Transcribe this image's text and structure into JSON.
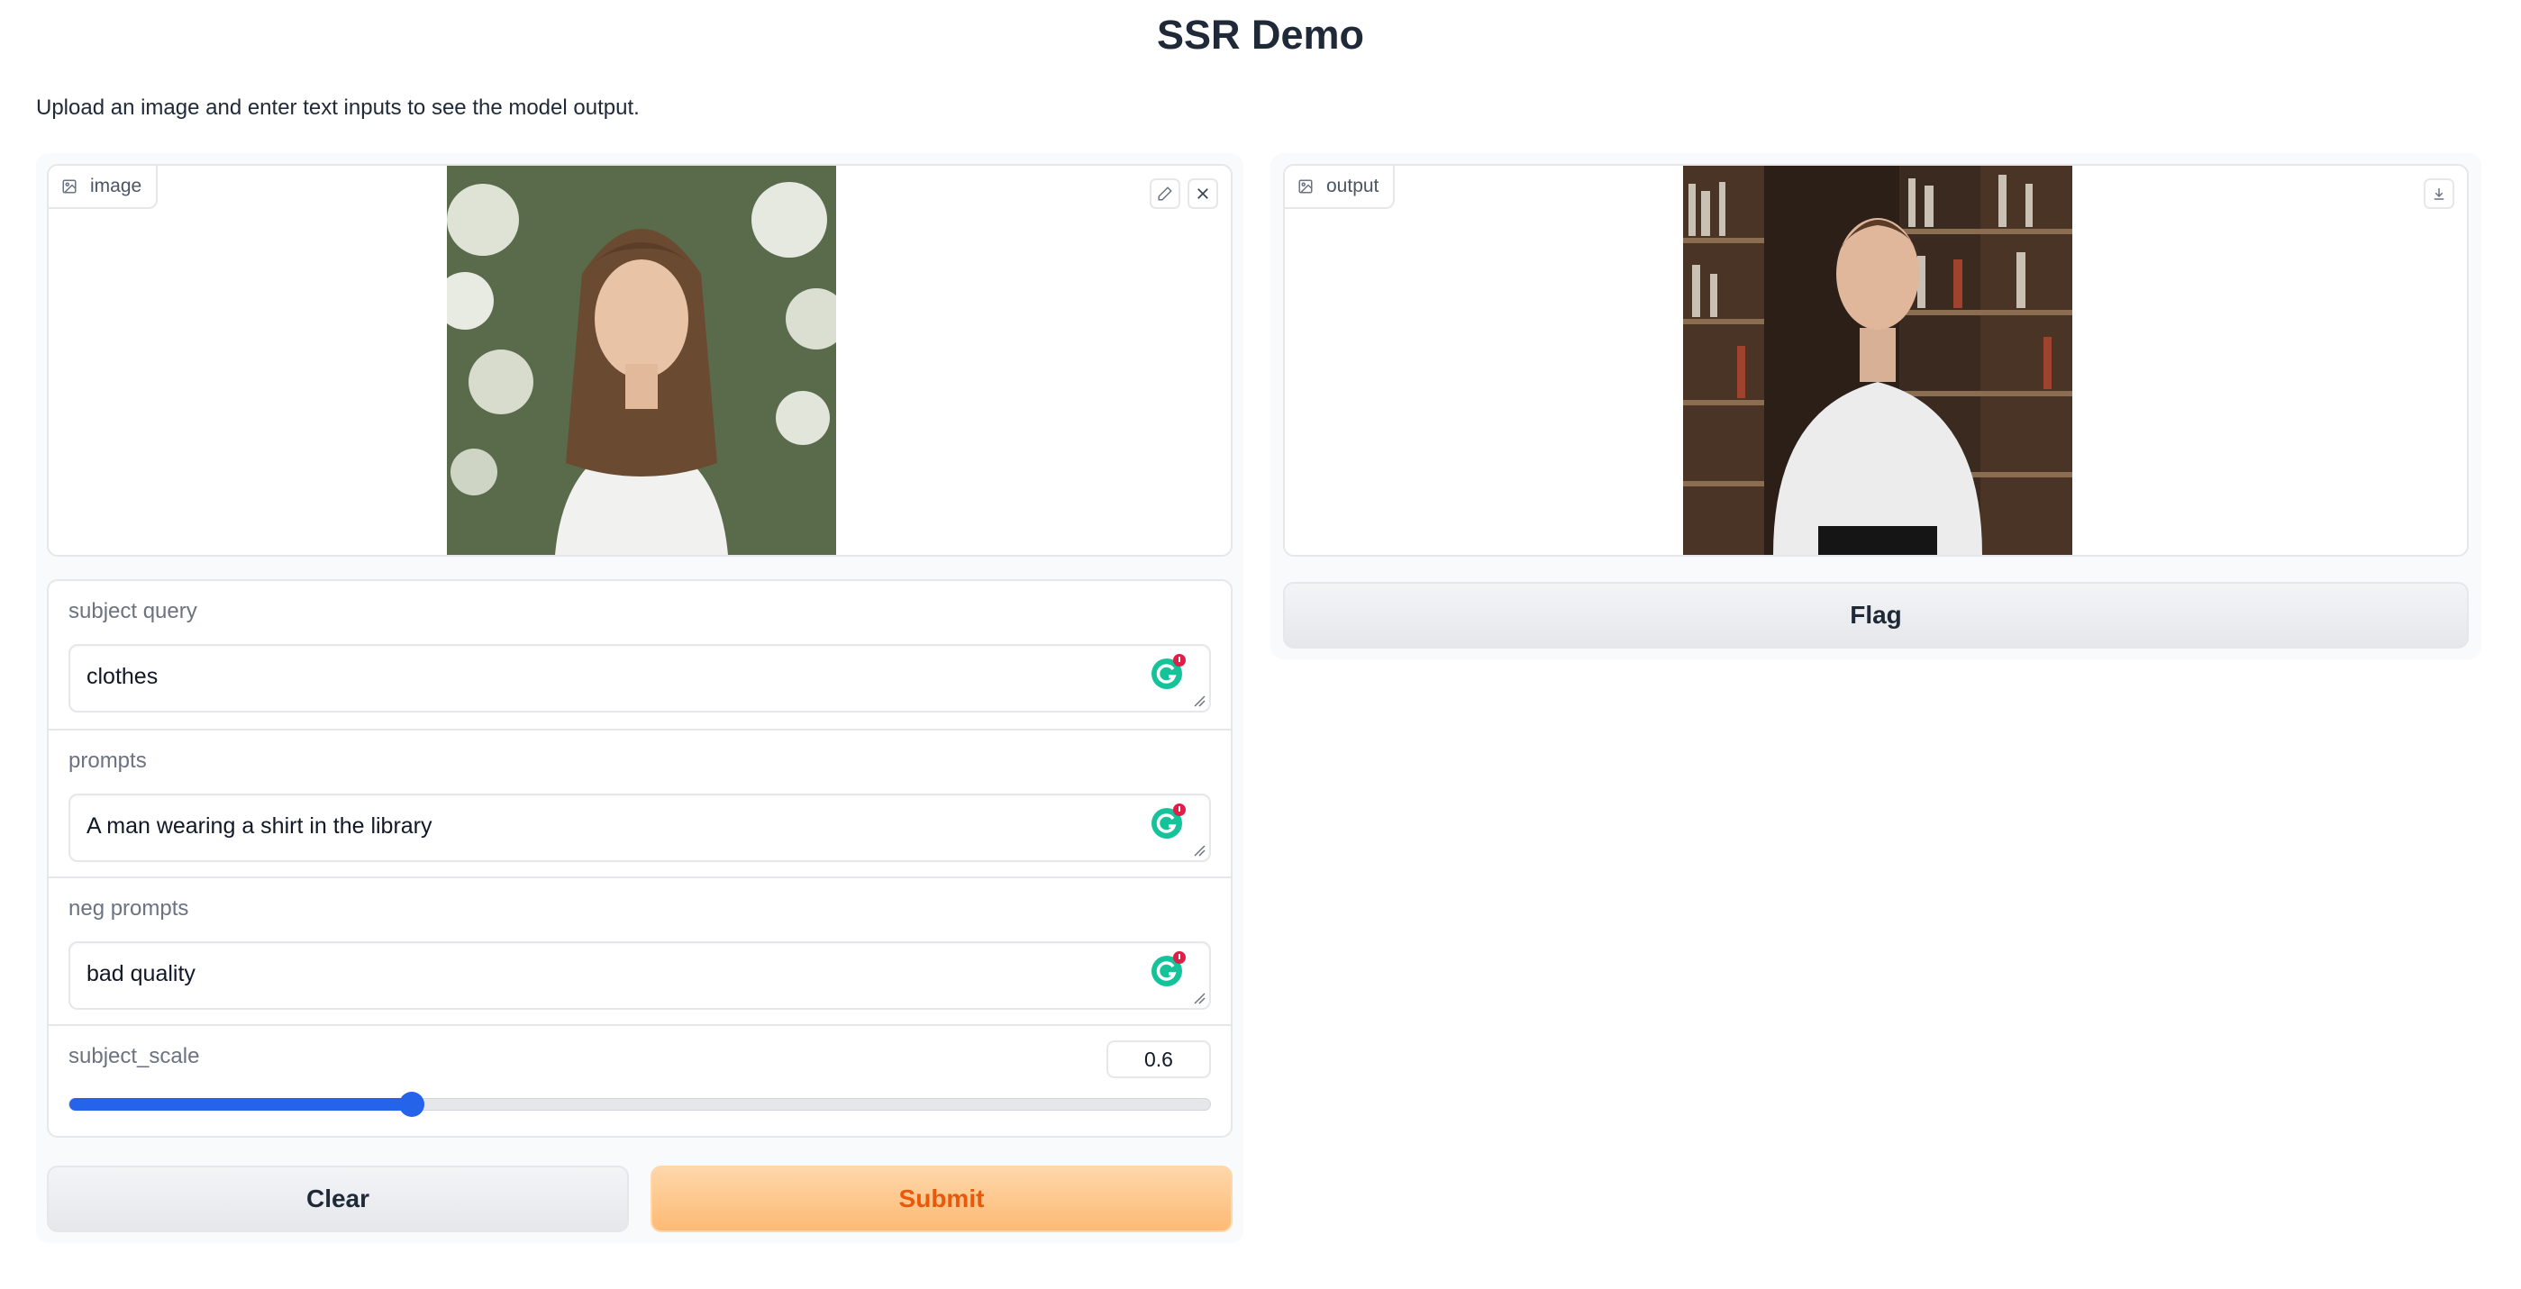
{
  "page": {
    "title": "SSR Demo",
    "description": "Upload an image and enter text inputs to see the model output."
  },
  "input_panel": {
    "image": {
      "label": "image",
      "icon": "image-icon",
      "actions": [
        "edit-icon",
        "close-icon"
      ]
    },
    "fields": [
      {
        "label": "subject query",
        "value": "clothes"
      },
      {
        "label": "prompts",
        "value": "A man wearing a shirt in the library"
      },
      {
        "label": "neg prompts",
        "value": "bad quality"
      }
    ],
    "slider": {
      "label": "subject_scale",
      "value": "0.6",
      "fraction": 0.3
    },
    "buttons": {
      "clear": "Clear",
      "submit": "Submit"
    }
  },
  "output_panel": {
    "image": {
      "label": "output",
      "icon": "image-icon",
      "actions": [
        "download-icon"
      ]
    },
    "flag": "Flag"
  },
  "colors": {
    "accent": "#2563eb",
    "submit_bg": "#fdba74",
    "submit_text": "#ea580c",
    "grammarly": "#15c39a",
    "grammarly_badge": "#e11d48"
  }
}
